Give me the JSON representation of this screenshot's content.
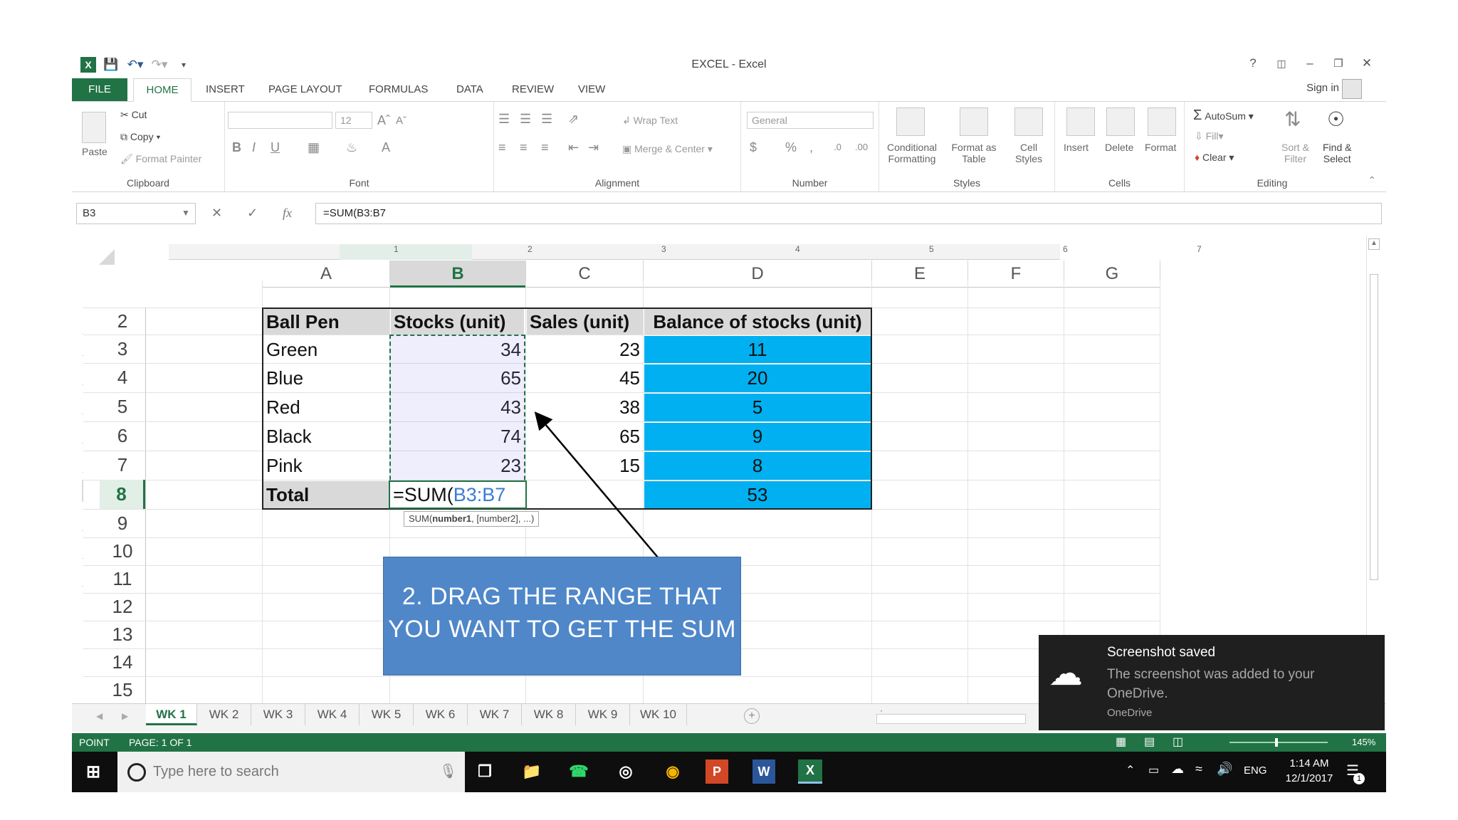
{
  "window": {
    "title": "EXCEL - Excel"
  },
  "ribbon": {
    "tabs": [
      "FILE",
      "HOME",
      "INSERT",
      "PAGE LAYOUT",
      "FORMULAS",
      "DATA",
      "REVIEW",
      "VIEW"
    ],
    "signin": "Sign in",
    "clipboard": {
      "paste": "Paste",
      "cut": "Cut",
      "copy": "Copy",
      "format_painter": "Format Painter",
      "label": "Clipboard"
    },
    "font": {
      "size": "12",
      "label": "Font"
    },
    "alignment": {
      "wrap_text": "Wrap Text",
      "merge_center": "Merge & Center",
      "label": "Alignment"
    },
    "number": {
      "format": "General",
      "label": "Number"
    },
    "styles": {
      "conditional": "Conditional",
      "conditional2": "Formatting",
      "format_as": "Format as",
      "format_as2": "Table",
      "cell": "Cell",
      "cell2": "Styles",
      "label": "Styles"
    },
    "cells": {
      "insert": "Insert",
      "delete": "Delete",
      "format": "Format",
      "label": "Cells"
    },
    "editing": {
      "autosum": "AutoSum",
      "fill": "Fill",
      "clear": "Clear",
      "sort": "Sort &",
      "sort2": "Filter",
      "find": "Find &",
      "find2": "Select",
      "label": "Editing"
    }
  },
  "formula_bar": {
    "name_box": "B3",
    "formula": "=SUM(B3:B7"
  },
  "ruler": [
    "1",
    "2",
    "3",
    "4",
    "5",
    "6",
    "7"
  ],
  "columns": [
    "A",
    "B",
    "C",
    "D",
    "E",
    "F",
    "G"
  ],
  "rows": [
    "2",
    "3",
    "4",
    "5",
    "6",
    "7",
    "8",
    "9",
    "10",
    "11",
    "12",
    "13",
    "14",
    "15"
  ],
  "table": {
    "headers": [
      "Ball Pen",
      "Stocks (unit)",
      "Sales (unit)",
      "Balance of stocks (unit)"
    ],
    "rows": [
      [
        "Green",
        "34",
        "23",
        "11"
      ],
      [
        "Blue",
        "65",
        "45",
        "20"
      ],
      [
        "Red",
        "43",
        "38",
        "5"
      ],
      [
        "Black",
        "74",
        "65",
        "9"
      ],
      [
        "Pink",
        "23",
        "15",
        "8"
      ]
    ],
    "total_label": "Total",
    "total_formula_prefix": "=SUM(",
    "total_formula_range": "B3:B7",
    "total_balance": "53"
  },
  "tooltip": {
    "fn": "SUM(",
    "arg": "number1",
    "rest": ", [number2], ...)"
  },
  "callout": {
    "line1": "2. DRAG THE RANGE THAT",
    "line2": "YOU WANT TO GET THE SUM"
  },
  "sheets": [
    "WK 1",
    "WK 2",
    "WK 3",
    "WK 4",
    "WK 5",
    "WK 6",
    "WK 7",
    "WK 8",
    "WK 9",
    "WK 10"
  ],
  "status": {
    "mode": "POINT",
    "page": "PAGE: 1 OF 1",
    "zoom": "145%"
  },
  "taskbar": {
    "search_placeholder": "Type here to search",
    "lang": "ENG",
    "time": "1:14 AM",
    "date": "12/1/2017",
    "notif_count": "1"
  },
  "toast": {
    "title": "Screenshot saved",
    "body1": "The screenshot was added to your",
    "body2": "OneDrive.",
    "source": "OneDrive"
  },
  "colors": {
    "excel_green": "#217346",
    "accent_blue": "#00b0f0",
    "callout": "#4f87c9"
  }
}
